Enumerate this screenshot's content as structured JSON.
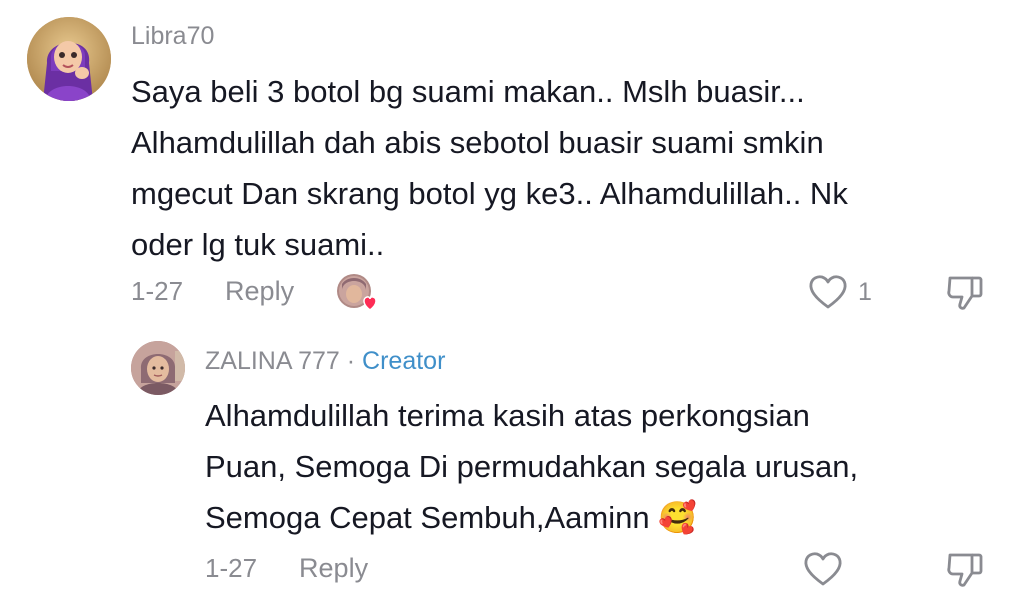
{
  "comment": {
    "username": "Libra70",
    "text_lines": [
      "Saya beli 3 botol bg suami makan.. Mslh buasir...",
      "Alhamdulillah dah abis sebotol buasir suami smkin",
      "mgecut Dan skrang botol yg ke3.. Alhamdulillah.. Nk",
      "oder lg tuk suami.."
    ],
    "date": "1-27",
    "reply_label": "Reply",
    "like_count": "1"
  },
  "reply": {
    "username": "ZALINA 777",
    "separator": "·",
    "badge": "Creator",
    "text_lines": [
      "Alhamdulillah terima kasih atas perkongsian",
      "Puan, Semoga Di permudahkan segala urusan,",
      "Semoga Cepat Sembuh,Aaminn"
    ],
    "emoji": "🥰",
    "date": "1-27",
    "reply_label": "Reply"
  },
  "icons": {
    "avatar_main": "hijab-cartoon-avatar",
    "avatar_reply": "profile-photo-avatar",
    "liked_by_creator": "creator-liked-avatar",
    "like": "heart-outline-icon",
    "dislike": "thumbs-down-icon"
  },
  "colors": {
    "text": "#161823",
    "muted": "#8a8b91",
    "creator": "#3f8fc9",
    "heart_badge": "#fe2c55"
  }
}
